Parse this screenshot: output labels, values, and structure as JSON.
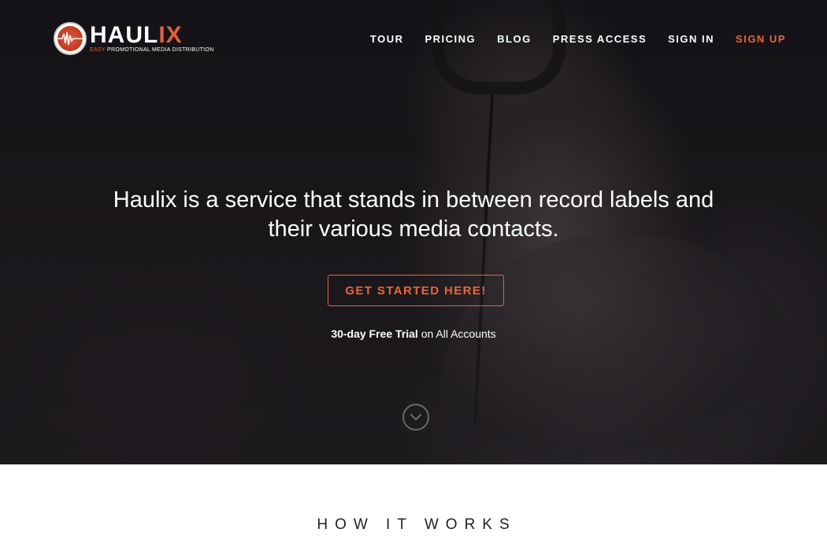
{
  "brand": {
    "name_main": "HAUL",
    "name_accent": "IX",
    "tagline_accent": "EASY",
    "tagline_rest": " PROMOTIONAL MEDIA DISTRIBUTION",
    "accent_color": "#e8663f"
  },
  "nav": {
    "items": [
      {
        "label": "TOUR"
      },
      {
        "label": "PRICING"
      },
      {
        "label": "BLOG"
      },
      {
        "label": "PRESS ACCESS"
      },
      {
        "label": "SIGN IN"
      },
      {
        "label": "SIGN UP"
      }
    ]
  },
  "hero": {
    "headline": "Haulix is a service that stands in between record labels and their various media contacts.",
    "cta_label": "GET STARTED HERE!",
    "trial_strong": "30-day Free Trial",
    "trial_rest": " on All Accounts",
    "scroll_icon": "chevron-down-circle-icon"
  },
  "how_it_works": {
    "title": "HOW IT WORKS"
  }
}
